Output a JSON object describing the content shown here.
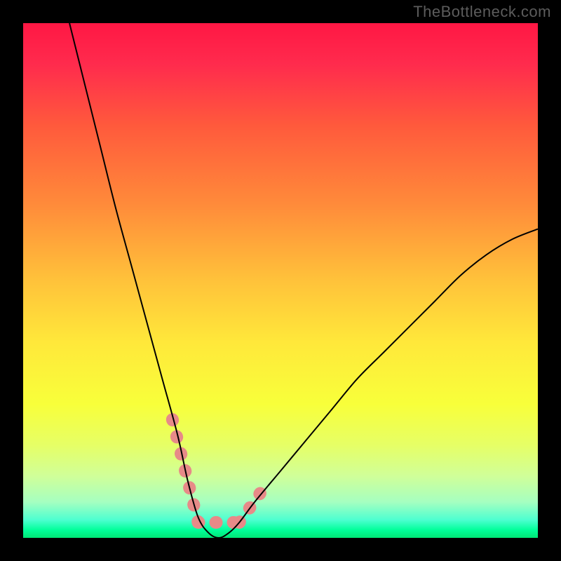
{
  "watermark": "TheBottleneck.com",
  "chart_data": {
    "type": "line",
    "title": "",
    "xlabel": "",
    "ylabel": "",
    "xlim": [
      0,
      100
    ],
    "ylim": [
      0,
      100
    ],
    "annotations": "Bottleneck curve: V-shaped function with minimum plateau around x≈34-40 at y≈0. Left steep descent from (9,100) to (34,0); right gentler ascent from (40,0) to (100,60). Highlighted salmon band segments mark the approach to and departure from the minimum.",
    "series": [
      {
        "name": "curve",
        "x": [
          9,
          12,
          15,
          18,
          21,
          24,
          27,
          30,
          32,
          34,
          36,
          38,
          40,
          42,
          45,
          50,
          55,
          60,
          65,
          70,
          75,
          80,
          85,
          90,
          95,
          100
        ],
        "y": [
          100,
          88,
          76,
          64,
          53,
          42,
          31,
          20,
          11,
          4,
          1,
          0,
          1,
          3,
          7,
          13,
          19,
          25,
          31,
          36,
          41,
          46,
          51,
          55,
          58,
          60
        ]
      }
    ],
    "highlight_segments": [
      {
        "x": [
          29,
          34
        ],
        "y": [
          23,
          3
        ]
      },
      {
        "x": [
          34,
          42
        ],
        "y": [
          3,
          3
        ]
      },
      {
        "x": [
          42,
          47
        ],
        "y": [
          3,
          10
        ]
      }
    ],
    "gradient_stops": [
      {
        "offset": 0.0,
        "color": "#ff1744"
      },
      {
        "offset": 0.08,
        "color": "#ff2b4d"
      },
      {
        "offset": 0.2,
        "color": "#ff5a3c"
      },
      {
        "offset": 0.35,
        "color": "#ff8a3a"
      },
      {
        "offset": 0.5,
        "color": "#ffc23a"
      },
      {
        "offset": 0.62,
        "color": "#ffe83a"
      },
      {
        "offset": 0.74,
        "color": "#f8ff3a"
      },
      {
        "offset": 0.82,
        "color": "#e6ff66"
      },
      {
        "offset": 0.88,
        "color": "#d0ff99"
      },
      {
        "offset": 0.93,
        "color": "#a6ffc0"
      },
      {
        "offset": 0.965,
        "color": "#4dffd0"
      },
      {
        "offset": 0.985,
        "color": "#00ff99"
      },
      {
        "offset": 1.0,
        "color": "#00e676"
      }
    ],
    "highlight_color": "#e78a88",
    "curve_color": "#000000"
  }
}
